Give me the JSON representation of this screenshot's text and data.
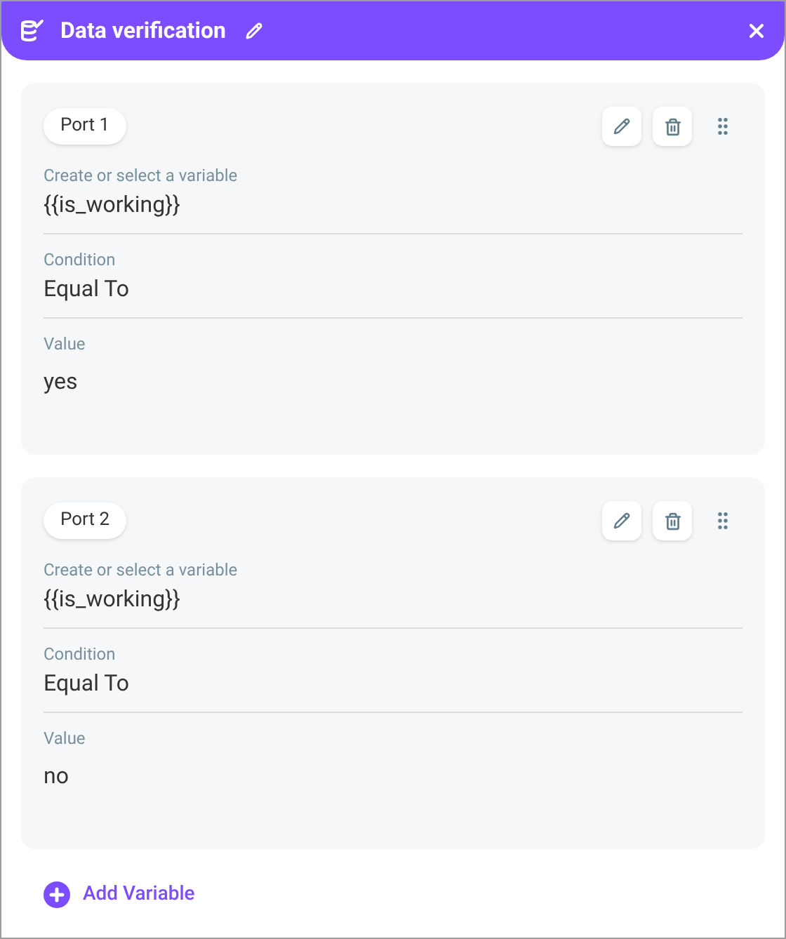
{
  "header": {
    "title": "Data verification"
  },
  "ports": [
    {
      "name": "Port 1",
      "fields": [
        {
          "label": "Create or select a variable",
          "value": "{{is_working}}"
        },
        {
          "label": "Condition",
          "value": "Equal To"
        },
        {
          "label": "Value",
          "value": "yes"
        }
      ]
    },
    {
      "name": "Port 2",
      "fields": [
        {
          "label": "Create or select a variable",
          "value": "{{is_working}}"
        },
        {
          "label": "Condition",
          "value": "Equal To"
        },
        {
          "label": "Value",
          "value": "no"
        }
      ]
    }
  ],
  "add_button": {
    "label": "Add Variable"
  }
}
